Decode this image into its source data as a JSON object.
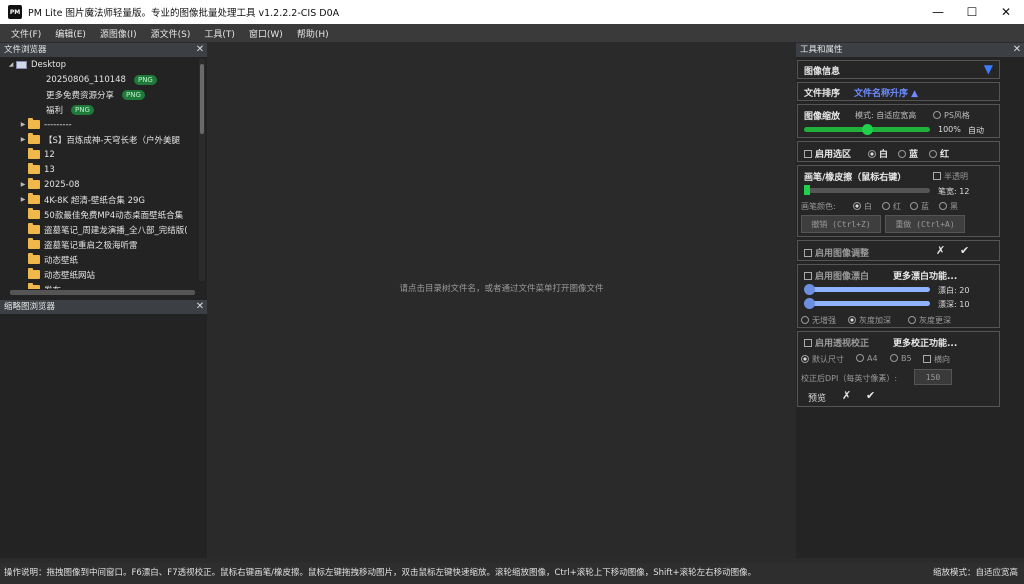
{
  "window": {
    "title": "PM Lite 图片魔法师轻量版。专业的图像批量处理工具 v1.2.2.2-CIS D0A",
    "logo": "PM",
    "controls": [
      "—",
      "☐",
      "✕"
    ]
  },
  "menu": [
    "文件(F)",
    "编辑(E)",
    "源图像(I)",
    "源文件(S)",
    "工具(T)",
    "窗口(W)",
    "帮助(H)"
  ],
  "file_browser": {
    "title": "文件浏览器",
    "close": "✕",
    "root": "Desktop",
    "files": [
      {
        "name": "20250806_110148",
        "badge": "PNG"
      },
      {
        "name": "更多免费资源分享",
        "badge": "PNG"
      },
      {
        "name": "福利",
        "badge": "PNG"
      }
    ],
    "folders": [
      {
        "name": "---------",
        "expandable": true
      },
      {
        "name": "【S】百炼成神-天穹长老（户外美腿",
        "expandable": true
      },
      {
        "name": "12",
        "expandable": false
      },
      {
        "name": "13",
        "expandable": false
      },
      {
        "name": "2025-08",
        "expandable": true
      },
      {
        "name": "4K-8K 超清-壁纸合集 29G",
        "expandable": true
      },
      {
        "name": "50款最佳免费MP4动态桌面壁纸合集",
        "expandable": false
      },
      {
        "name": "盗墓笔记_周建龙演播_全八部_完结版(",
        "expandable": false
      },
      {
        "name": "盗墓笔记重启之极海听雷",
        "expandable": false
      },
      {
        "name": "动态壁纸",
        "expandable": false
      },
      {
        "name": "动态壁纸网站",
        "expandable": false
      },
      {
        "name": "发布",
        "expandable": false
      }
    ]
  },
  "thumb_browser": {
    "title": "缩略图浏览器",
    "close": "✕"
  },
  "center": {
    "hint": "请点击目录树文件名，或者通过文件菜单打开图像文件"
  },
  "tools": {
    "title": "工具和属性",
    "close": "✕",
    "image_info": {
      "label": "图像信息",
      "arrow": "▼"
    },
    "sort": {
      "label": "文件排序",
      "value": "文件名称升序 ▲"
    },
    "zoom": {
      "label": "图像缩放",
      "mode": "模式: 自适应宽高",
      "ps": "PS风格",
      "percent": "100%",
      "auto": "自动",
      "level": 0.5
    },
    "selection": {
      "label": "启用选区",
      "white": "白",
      "blue": "蓝",
      "red": "红"
    },
    "brush": {
      "label": "画笔/橡皮擦（鼠标右键）",
      "half": "半透明",
      "width_label": "笔宽: 12",
      "color_label": "画笔颜色:",
      "colors": [
        "白",
        "红",
        "蓝",
        "黑"
      ],
      "undo": "撤销 (Ctrl+Z)",
      "redo": "重做 (Ctrl+A)"
    },
    "adjust": {
      "label": "启用图像调整",
      "cancel": "✗",
      "ok": "✔"
    },
    "bleach": {
      "label": "启用图像漂白",
      "more": "更多漂白功能...",
      "white": "漂白: 20",
      "depth": "漂深: 10",
      "options": [
        "无增强",
        "灰度加深",
        "灰度更深"
      ]
    },
    "perspective": {
      "label": "启用透视校正",
      "more": "更多校正功能...",
      "sizes": [
        "默认尺寸",
        "A4",
        "B5",
        "横向"
      ],
      "dpi_label": "校正后DPI（每英寸像素）:",
      "dpi_value": "150",
      "preview": "预览",
      "cancel": "✗",
      "ok": "✔"
    }
  },
  "status": {
    "text": "操作说明：拖拽图像到中间窗口。F6漂白、F7透视校正。鼠标右键画笔/橡皮擦。鼠标左键拖拽移动图片，双击鼠标左键快速缩放。滚轮缩放图像，Ctrl+滚轮上下移动图像，Shift+滚轮左右移动图像。",
    "zoom_mode": "缩放模式：自适应宽高"
  }
}
